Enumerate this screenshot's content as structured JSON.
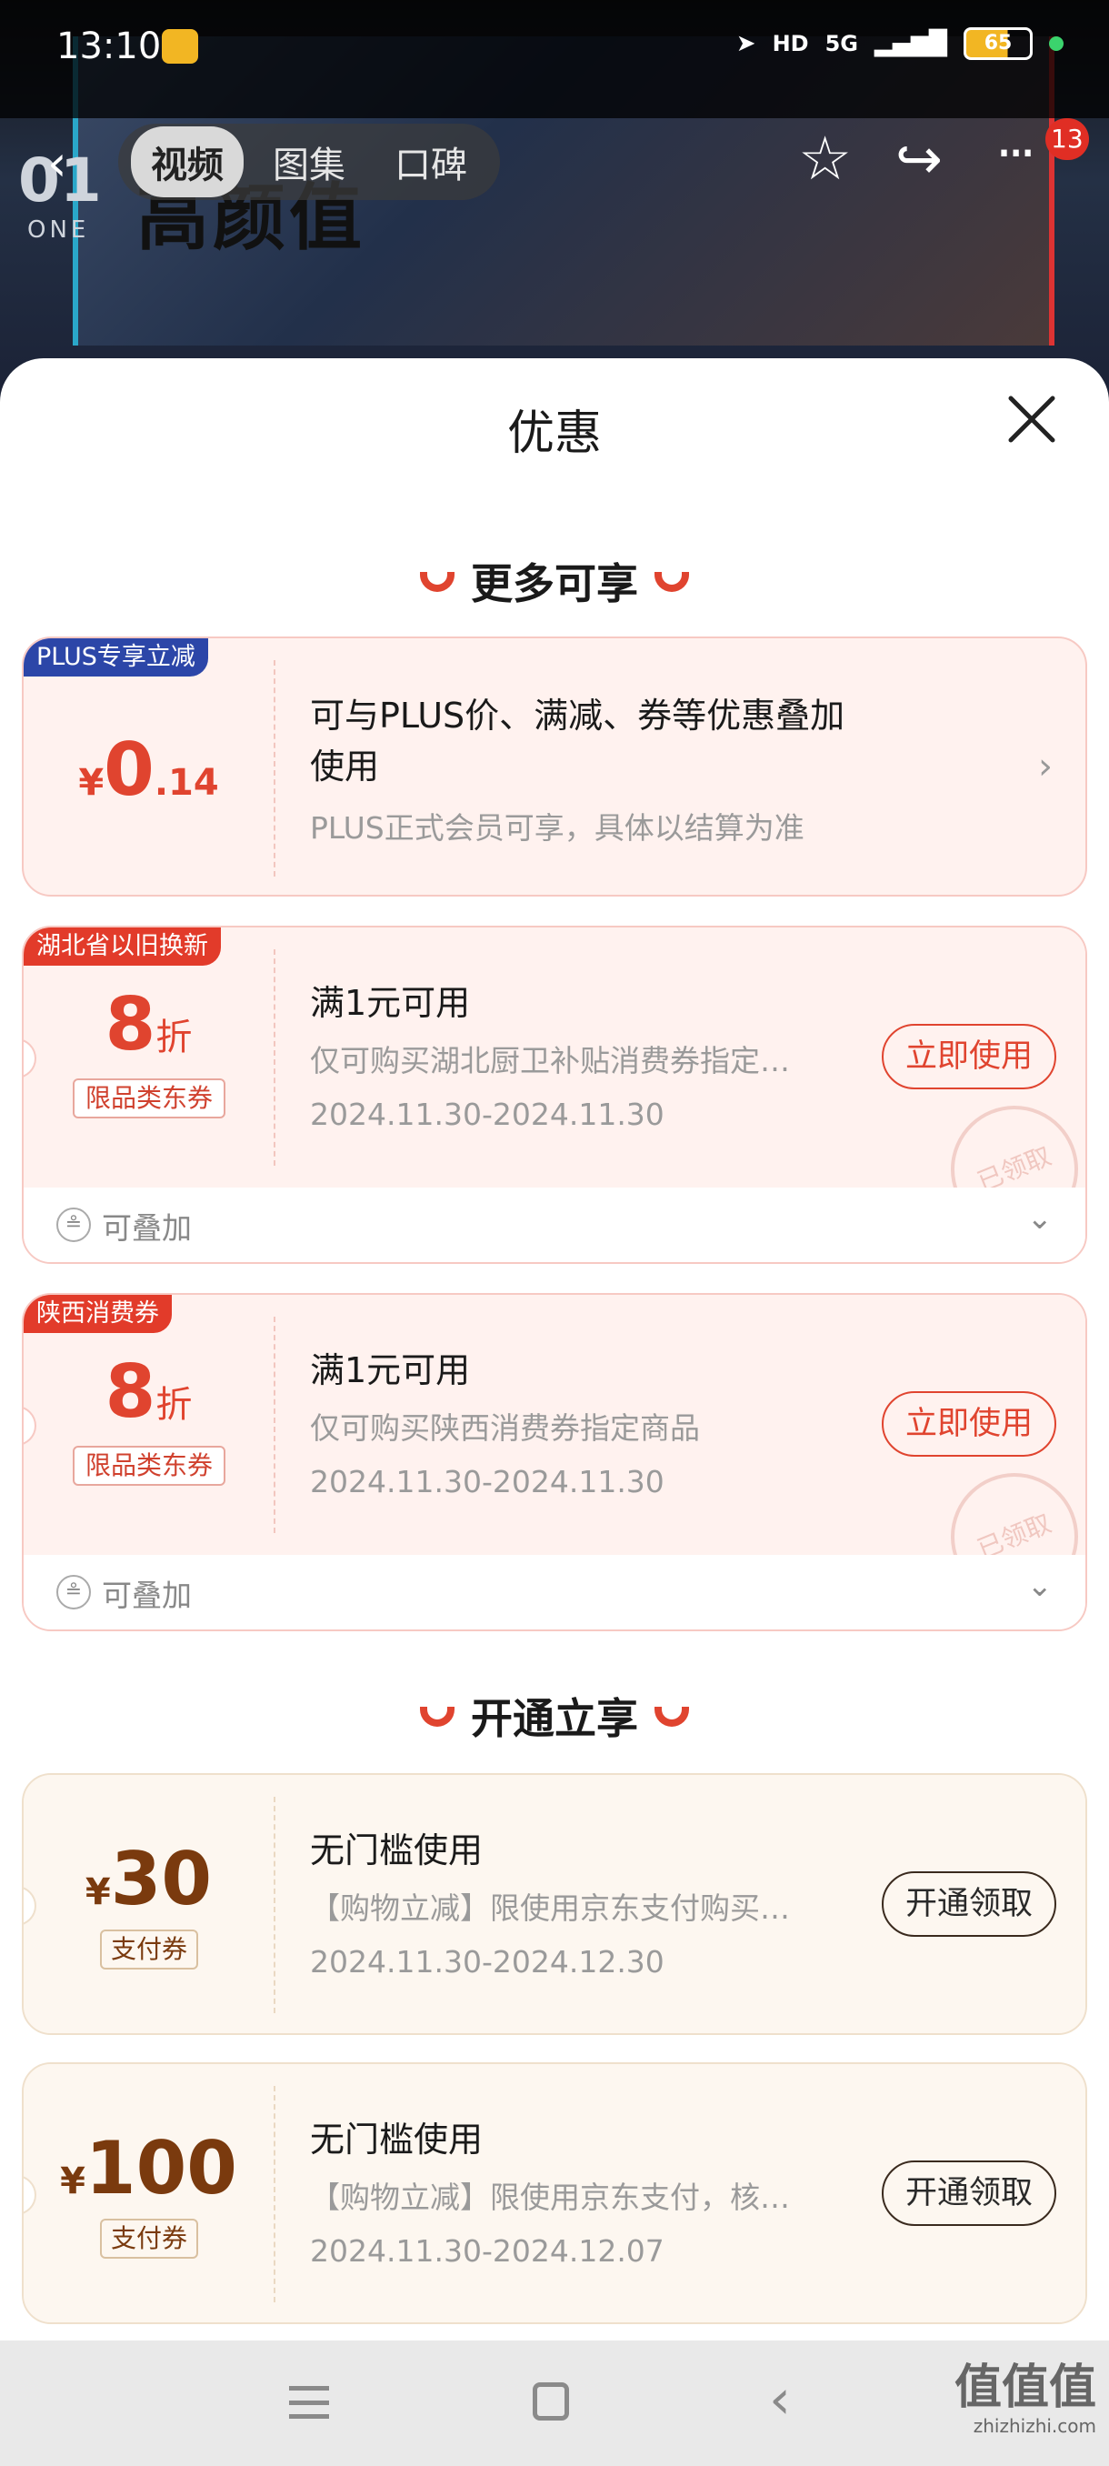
{
  "status_bar": {
    "time": "13:10",
    "hd": "HD",
    "net": "5G",
    "battery": "65"
  },
  "backdrop": {
    "episode_number": "01",
    "episode_word": "ONE",
    "poster_text": "高颜值"
  },
  "top_nav": {
    "tabs": [
      "视频",
      "图集",
      "口碑"
    ],
    "active_tab": "视频",
    "badge_count": "13"
  },
  "sheet": {
    "title": "优惠"
  },
  "sections": {
    "more": "更多可享",
    "open": "开通立享"
  },
  "plus_card": {
    "tag": "PLUS专享立减",
    "yen": "¥",
    "amount_int": "0",
    "amount_dec": ".14",
    "title_line1": "可与PLUS价、满减、券等优惠叠加",
    "title_line2": "使用",
    "desc": "PLUS正式会员可享，具体以结算为准"
  },
  "coupons": [
    {
      "tag": "湖北省以旧换新",
      "discount": "8",
      "unit": "折",
      "subtag": "限品类东券",
      "title": "满1元可用",
      "desc": "仅可购买湖北厨卫补贴消费券指定…",
      "date": "2024.11.30-2024.11.30",
      "button": "立即使用",
      "stamp": "已领取",
      "stack_label": "可叠加"
    },
    {
      "tag": "陕西消费券",
      "discount": "8",
      "unit": "折",
      "subtag": "限品类东券",
      "title": "满1元可用",
      "desc": "仅可购买陕西消费券指定商品",
      "date": "2024.11.30-2024.11.30",
      "button": "立即使用",
      "stamp": "已领取",
      "stack_label": "可叠加"
    }
  ],
  "pay_coupons": [
    {
      "yen": "¥",
      "amount": "30",
      "subtag": "支付券",
      "title": "无门槛使用",
      "desc": "【购物立减】限使用京东支付购买…",
      "date": "2024.11.30-2024.12.30",
      "button": "开通领取"
    },
    {
      "yen": "¥",
      "amount": "100",
      "subtag": "支付券",
      "title": "无门槛使用",
      "desc": "【购物立减】限使用京东支付，核…",
      "date": "2024.11.30-2024.12.07",
      "button": "开通领取"
    }
  ],
  "watermark": {
    "big": "值值值",
    "small": "zhizhizhi.com"
  },
  "colors": {
    "accent_red": "#e0442f",
    "plus_blue": "#2c46a8",
    "brown": "#7a3a0e"
  }
}
